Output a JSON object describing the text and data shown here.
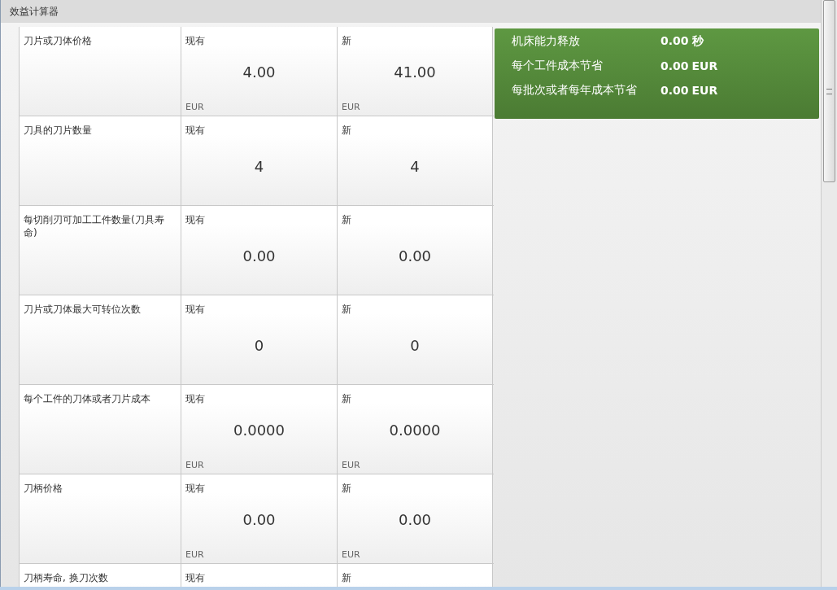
{
  "header": {
    "title": "效益计算器"
  },
  "rows": [
    {
      "label": "刀片或刀体价格",
      "existing": {
        "label": "现有",
        "value": "4.00",
        "unit": "EUR"
      },
      "new": {
        "label": "新",
        "value": "41.00",
        "unit": "EUR"
      }
    },
    {
      "label": "刀具的刀片数量",
      "existing": {
        "label": "现有",
        "value": "4"
      },
      "new": {
        "label": "新",
        "value": "4"
      }
    },
    {
      "label": "每切削刃可加工工件数量(刀具寿命)",
      "existing": {
        "label": "现有",
        "value": "0.00"
      },
      "new": {
        "label": "新",
        "value": "0.00"
      }
    },
    {
      "label": "刀片或刀体最大可转位次数",
      "existing": {
        "label": "现有",
        "value": "0"
      },
      "new": {
        "label": "新",
        "value": "0"
      }
    },
    {
      "label": "每个工件的刀体或者刀片成本",
      "existing": {
        "label": "现有",
        "value": "0.0000",
        "unit": "EUR"
      },
      "new": {
        "label": "新",
        "value": "0.0000",
        "unit": "EUR"
      }
    },
    {
      "label": "刀柄价格",
      "existing": {
        "label": "现有",
        "value": "0.00",
        "unit": "EUR"
      },
      "new": {
        "label": "新",
        "value": "0.00",
        "unit": "EUR"
      }
    },
    {
      "label": "刀柄寿命, 换刀次数",
      "existing": {
        "label": "现有"
      },
      "new": {
        "label": "新"
      }
    }
  ],
  "summary": [
    {
      "label": "机床能力释放",
      "value": "0.00",
      "unit": "秒"
    },
    {
      "label": "每个工件成本节省",
      "value": "0.00",
      "unit": "EUR"
    },
    {
      "label": "每批次或者每年成本节省",
      "value": "0.00",
      "unit": "EUR"
    }
  ]
}
